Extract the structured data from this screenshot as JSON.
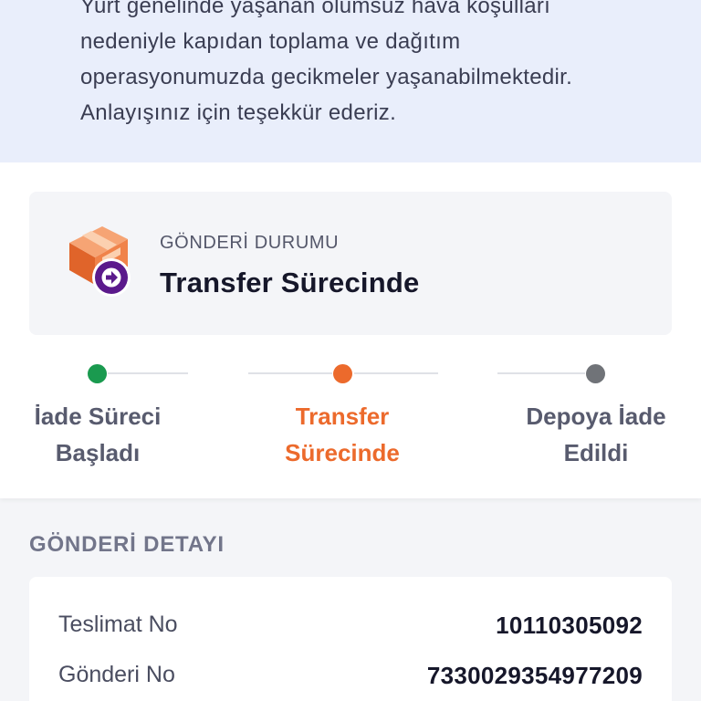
{
  "notice": {
    "lines": [
      "Yurt genelinde yaşanan olumsuz hava koşulları",
      "nedeniyle kapıdan toplama ve dağıtım",
      "operasyonumuzda gecikmeler yaşanabilmektedir.",
      "Anlayışınız için teşekkür ederiz."
    ]
  },
  "status": {
    "label": "GÖNDERİ DURUMU",
    "value": "Transfer Sürecinde",
    "icon": "package-transfer-icon"
  },
  "timeline": [
    {
      "line1": "İade Süreci",
      "line2": "Başladı",
      "state": "completed",
      "dot_color": "#1a9a4f",
      "text_color": "#585b6e"
    },
    {
      "line1": "Transfer",
      "line2": "Sürecinde",
      "state": "active",
      "dot_color": "#ec6a2c",
      "text_color": "#ec6a2c"
    },
    {
      "line1": "Depoya İade",
      "line2": "Edildi",
      "state": "pending",
      "dot_color": "#707378",
      "text_color": "#585b6e"
    }
  ],
  "details": {
    "heading": "GÖNDERİ DETAYI",
    "rows": [
      {
        "label": "Teslimat No",
        "value": "10110305092"
      },
      {
        "label": "Gönderi No",
        "value": "7330029354977209"
      }
    ]
  },
  "colors": {
    "brand_purple": "#5b1a8c",
    "box_orange": "#ef7d3c",
    "notice_bg": "#e9eefb"
  }
}
